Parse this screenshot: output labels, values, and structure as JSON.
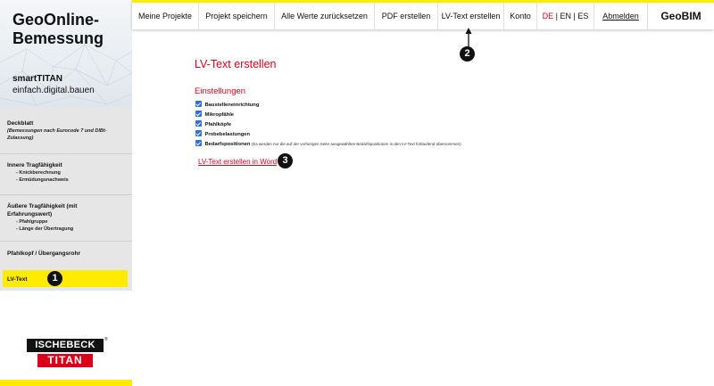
{
  "brand": {
    "title_line1": "GeoOnline-",
    "title_line2": "Bemessung",
    "sub1": "smartTITAN",
    "sub2": "einfach.digital.bauen"
  },
  "nav": {
    "projects": "Meine Projekte",
    "save": "Projekt speichern",
    "reset": "Alle Werte zurücksetzen",
    "pdf": "PDF erstellen",
    "lvtext": "LV-Text erstellen",
    "account": "Konto",
    "lang_de": "DE",
    "lang_sep1": " | ",
    "lang_en": "EN",
    "lang_sep2": " | ",
    "lang_es": "ES",
    "logout": "Abmelden",
    "geobim": "GeoBIM"
  },
  "sidebar": {
    "deckblatt": "Deckblatt",
    "deckblatt_note": "(Bemessungen nach Eurocode 7 und DIBt-Zulassung)",
    "inner": "Innere Tragfähigkeit",
    "inner_sub1": "- Knickberechnung",
    "inner_sub2": "- Ermüdungsnachweis",
    "outer": "Äußere Tragfähigkeit (mit Erfahrungswert)",
    "outer_sub1": "- Pfahlgruppe",
    "outer_sub2": "- Länge der Übertragung",
    "pfahlkopf": "Pfahlkopf / Übergangsrohr",
    "lvtext": "LV-Text"
  },
  "logo": {
    "line1": "ISCHEBECK",
    "line2": "TITAN",
    "reg": "®"
  },
  "content": {
    "page_title": "LV-Text erstellen",
    "settings_title": "Einstellungen",
    "options": [
      {
        "label": "Baustelleneinrichtung",
        "checked": true,
        "note": ""
      },
      {
        "label": "Mikropfähle",
        "checked": true,
        "note": ""
      },
      {
        "label": "Pfahlköpfe",
        "checked": true,
        "note": ""
      },
      {
        "label": "Probebelastungen",
        "checked": true,
        "note": ""
      },
      {
        "label": "Bedarfspositionen",
        "checked": true,
        "note": "(Es werden nur die auf der vorherigen Seite ausgewählten Bedarfspositionen in den LV-Text fortlaufend übernommen)"
      }
    ],
    "word_link": "LV-Text erstellen in Word"
  },
  "badges": {
    "one": "1",
    "two": "2",
    "three": "3"
  },
  "colors": {
    "accent_red": "#d9001b",
    "highlight_yellow": "#ffeb00",
    "checkbox_blue": "#2a6fdb"
  }
}
